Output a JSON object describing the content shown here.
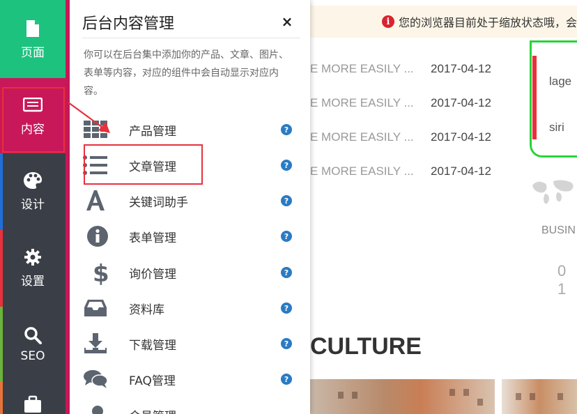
{
  "sidebar": {
    "items": [
      {
        "label": "页面",
        "icon": "file-icon"
      },
      {
        "label": "内容",
        "icon": "list-icon"
      },
      {
        "label": "设计",
        "icon": "palette-icon"
      },
      {
        "label": "设置",
        "icon": "gear-icon"
      },
      {
        "label": "SEO",
        "icon": "search-icon"
      },
      {
        "label": "",
        "icon": "briefcase-icon"
      }
    ]
  },
  "notice": {
    "text": "您的浏览器目前处于缩放状态哦，会"
  },
  "background": {
    "articles": [
      {
        "title": "E MORE EASILY ...",
        "date": "2017-04-12"
      },
      {
        "title": "E MORE EASILY ...",
        "date": "2017-04-12"
      },
      {
        "title": "E MORE EASILY ...",
        "date": "2017-04-12"
      },
      {
        "title": "E MORE EASILY ...",
        "date": "2017-04-12"
      }
    ],
    "side_texts": [
      "lage",
      "siri"
    ],
    "busin": "BUSIN",
    "num": "0 1",
    "culture": "CULTURE"
  },
  "panel": {
    "title": "后台内容管理",
    "close": "×",
    "description": "你可以在后台集中添加你的产品、文章、图片、表单等内容，对应的组件中会自动显示对应内容。",
    "items": [
      {
        "label": "产品管理",
        "icon": "grid-icon",
        "help": "?"
      },
      {
        "label": "文章管理",
        "icon": "list-icon",
        "help": "?"
      },
      {
        "label": "关键词助手",
        "icon": "font-icon",
        "help": "?"
      },
      {
        "label": "表单管理",
        "icon": "info-icon",
        "help": "?"
      },
      {
        "label": "询价管理",
        "icon": "dollar-icon",
        "help": "?"
      },
      {
        "label": "资料库",
        "icon": "inbox-icon",
        "help": "?"
      },
      {
        "label": "下载管理",
        "icon": "download-icon",
        "help": "?"
      },
      {
        "label": "FAQ管理",
        "icon": "comments-icon",
        "help": "?"
      },
      {
        "label": "会员管理",
        "icon": "user-icon",
        "help": "?"
      }
    ]
  },
  "colors": {
    "sidebar_bg": "#3a3f47",
    "page_active": "#1dc27f",
    "content_active": "#c8185a",
    "highlight_red": "#e8303c",
    "help_blue": "#2a7bc4"
  }
}
